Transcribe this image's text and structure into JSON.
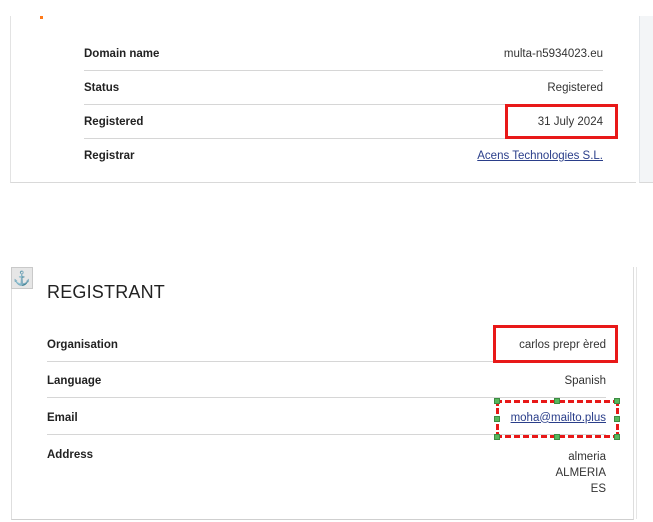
{
  "domain_card": {
    "rows": [
      {
        "label": "Domain name",
        "value": "multa-n5934023.eu"
      },
      {
        "label": "Status",
        "value": "Registered"
      },
      {
        "label": "Registered",
        "value": "31 July 2024"
      },
      {
        "label": "Registrar",
        "value": "Acens Technologies S.L."
      }
    ]
  },
  "registrant": {
    "title": "REGISTRANT",
    "anchor_icon": "⚓",
    "rows": [
      {
        "label": "Organisation",
        "value": "carlos prepr èred"
      },
      {
        "label": "Language",
        "value": "Spanish"
      },
      {
        "label": "Email",
        "value": "moha@mailto.plus"
      },
      {
        "label": "Address",
        "lines": [
          "almeria",
          "ALMERIA",
          "ES"
        ]
      }
    ]
  },
  "colors": {
    "highlight": "#e81818",
    "link": "#2a3e8a",
    "handle": "#58b85e"
  }
}
